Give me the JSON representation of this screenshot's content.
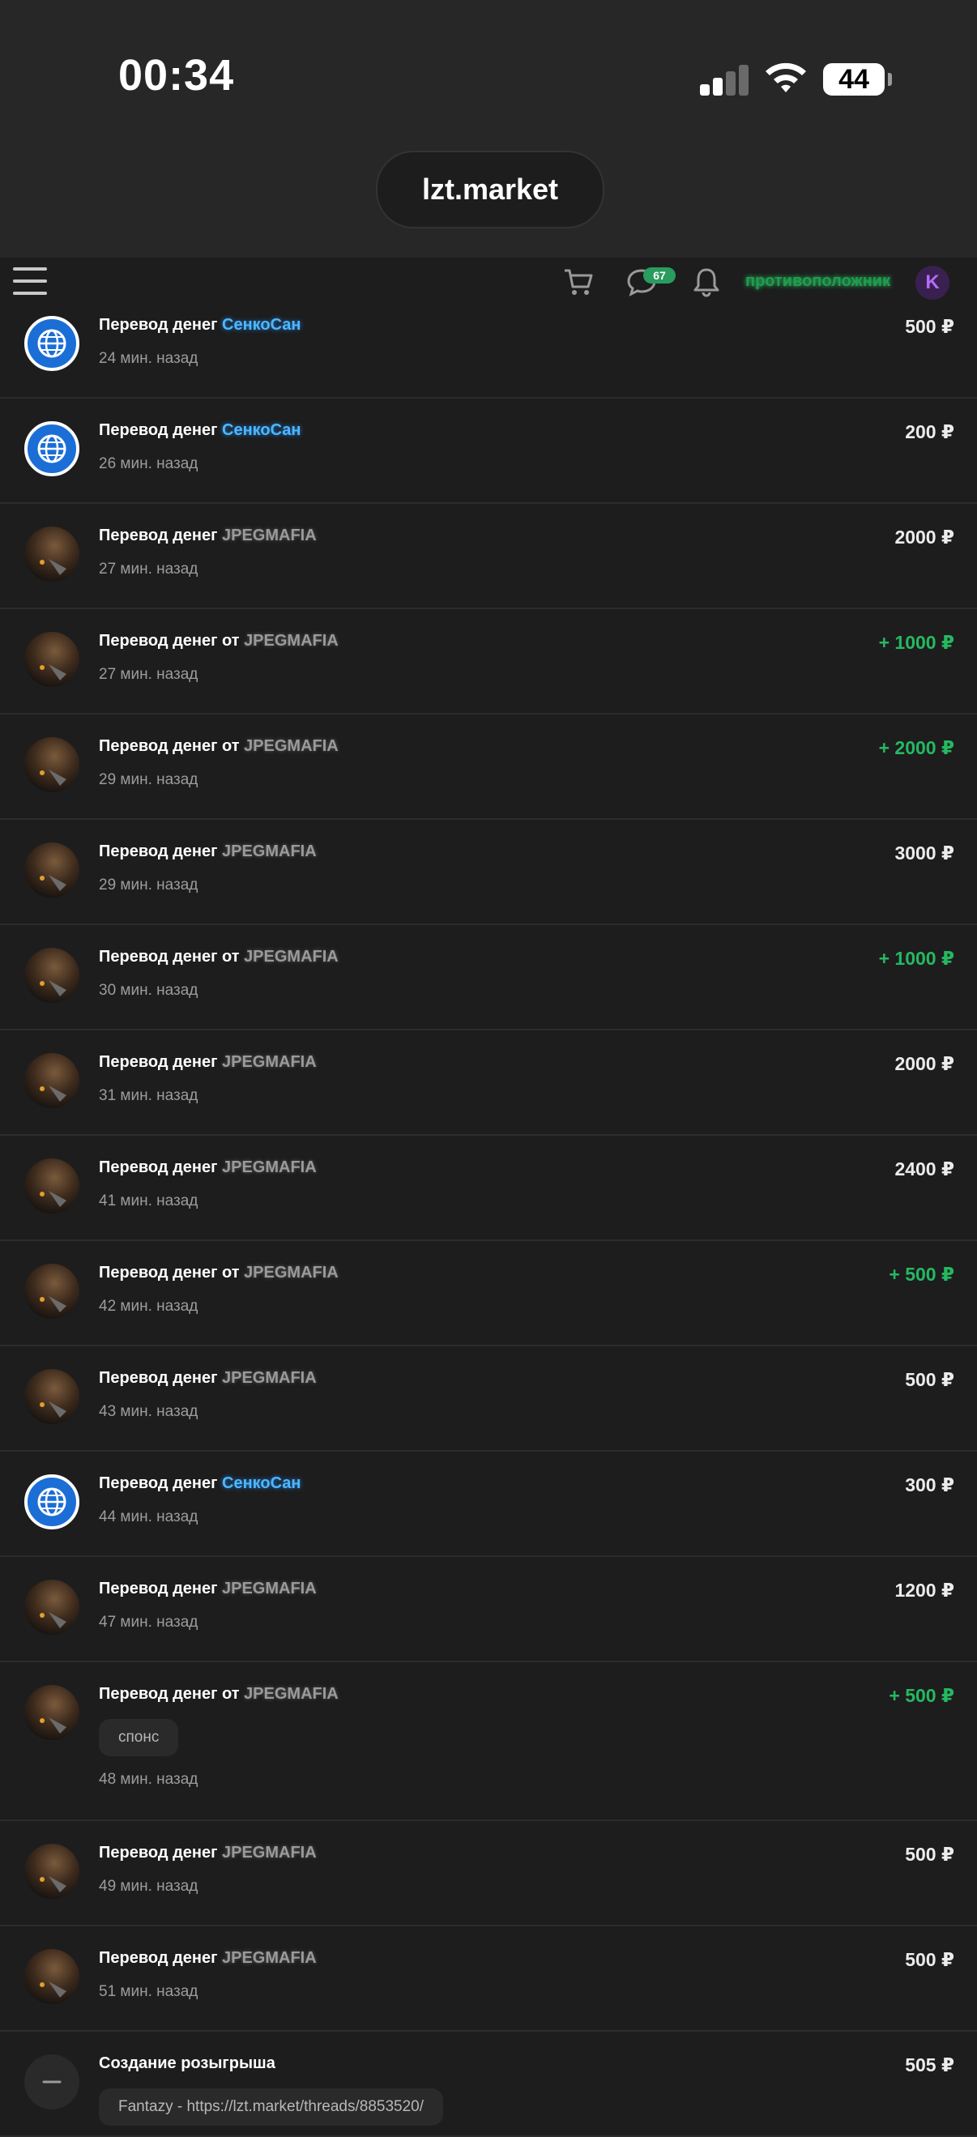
{
  "status_bar": {
    "time": "00:34",
    "battery": "44",
    "url": "lzt.market"
  },
  "header": {
    "cart_icon": "cart-icon",
    "messages_icon": "chat-icon",
    "messages_badge": "67",
    "notifications_icon": "bell-icon",
    "username": "противоположник",
    "avatar_letter": "K"
  },
  "colors": {
    "positive": "#25b861",
    "user_blue": "#4fb6ff",
    "background": "#1d1d1d"
  },
  "transactions": [
    {
      "title": "Перевод денег",
      "user": "СенкоСан",
      "user_style": "blue",
      "time": "24 мин. назад",
      "amount": "500 ₽",
      "positive": false,
      "avatar": "globe"
    },
    {
      "title": "Перевод денег",
      "user": "СенкоСан",
      "user_style": "blue",
      "time": "26 мин. назад",
      "amount": "200 ₽",
      "positive": false,
      "avatar": "globe"
    },
    {
      "title": "Перевод денег",
      "user": "JPEGMAFIA",
      "user_style": "gray",
      "time": "27 мин. назад",
      "amount": "2000 ₽",
      "positive": false,
      "avatar": "photo"
    },
    {
      "title": "Перевод денег от",
      "user": "JPEGMAFIA",
      "user_style": "gray",
      "time": "27 мин. назад",
      "amount": "+ 1000 ₽",
      "positive": true,
      "avatar": "photo"
    },
    {
      "title": "Перевод денег от",
      "user": "JPEGMAFIA",
      "user_style": "gray",
      "time": "29 мин. назад",
      "amount": "+ 2000 ₽",
      "positive": true,
      "avatar": "photo"
    },
    {
      "title": "Перевод денег",
      "user": "JPEGMAFIA",
      "user_style": "gray",
      "time": "29 мин. назад",
      "amount": "3000 ₽",
      "positive": false,
      "avatar": "photo"
    },
    {
      "title": "Перевод денег от",
      "user": "JPEGMAFIA",
      "user_style": "gray",
      "time": "30 мин. назад",
      "amount": "+ 1000 ₽",
      "positive": true,
      "avatar": "photo"
    },
    {
      "title": "Перевод денег",
      "user": "JPEGMAFIA",
      "user_style": "gray",
      "time": "31 мин. назад",
      "amount": "2000 ₽",
      "positive": false,
      "avatar": "photo"
    },
    {
      "title": "Перевод денег",
      "user": "JPEGMAFIA",
      "user_style": "gray",
      "time": "41 мин. назад",
      "amount": "2400 ₽",
      "positive": false,
      "avatar": "photo"
    },
    {
      "title": "Перевод денег от",
      "user": "JPEGMAFIA",
      "user_style": "gray",
      "time": "42 мин. назад",
      "amount": "+ 500 ₽",
      "positive": true,
      "avatar": "photo"
    },
    {
      "title": "Перевод денег",
      "user": "JPEGMAFIA",
      "user_style": "gray",
      "time": "43 мин. назад",
      "amount": "500 ₽",
      "positive": false,
      "avatar": "photo"
    },
    {
      "title": "Перевод денег",
      "user": "СенкоСан",
      "user_style": "blue",
      "time": "44 мин. назад",
      "amount": "300 ₽",
      "positive": false,
      "avatar": "globe"
    },
    {
      "title": "Перевод денег",
      "user": "JPEGMAFIA",
      "user_style": "gray",
      "time": "47 мин. назад",
      "amount": "1200 ₽",
      "positive": false,
      "avatar": "photo"
    },
    {
      "title": "Перевод денег от",
      "user": "JPEGMAFIA",
      "user_style": "gray",
      "time": "48 мин. назад",
      "amount": "+ 500 ₽",
      "positive": true,
      "avatar": "photo",
      "comment": "спонс"
    },
    {
      "title": "Перевод денег",
      "user": "JPEGMAFIA",
      "user_style": "gray",
      "time": "49 мин. назад",
      "amount": "500 ₽",
      "positive": false,
      "avatar": "photo"
    },
    {
      "title": "Перевод денег",
      "user": "JPEGMAFIA",
      "user_style": "gray",
      "time": "51 мин. назад",
      "amount": "500 ₽",
      "positive": false,
      "avatar": "photo"
    },
    {
      "title": "Создание розыгрыша",
      "user": "",
      "user_style": "",
      "time": "",
      "amount": "505 ₽",
      "positive": false,
      "avatar": "minus",
      "comment": "Fantazy - https://lzt.market/threads/8853520/"
    }
  ]
}
